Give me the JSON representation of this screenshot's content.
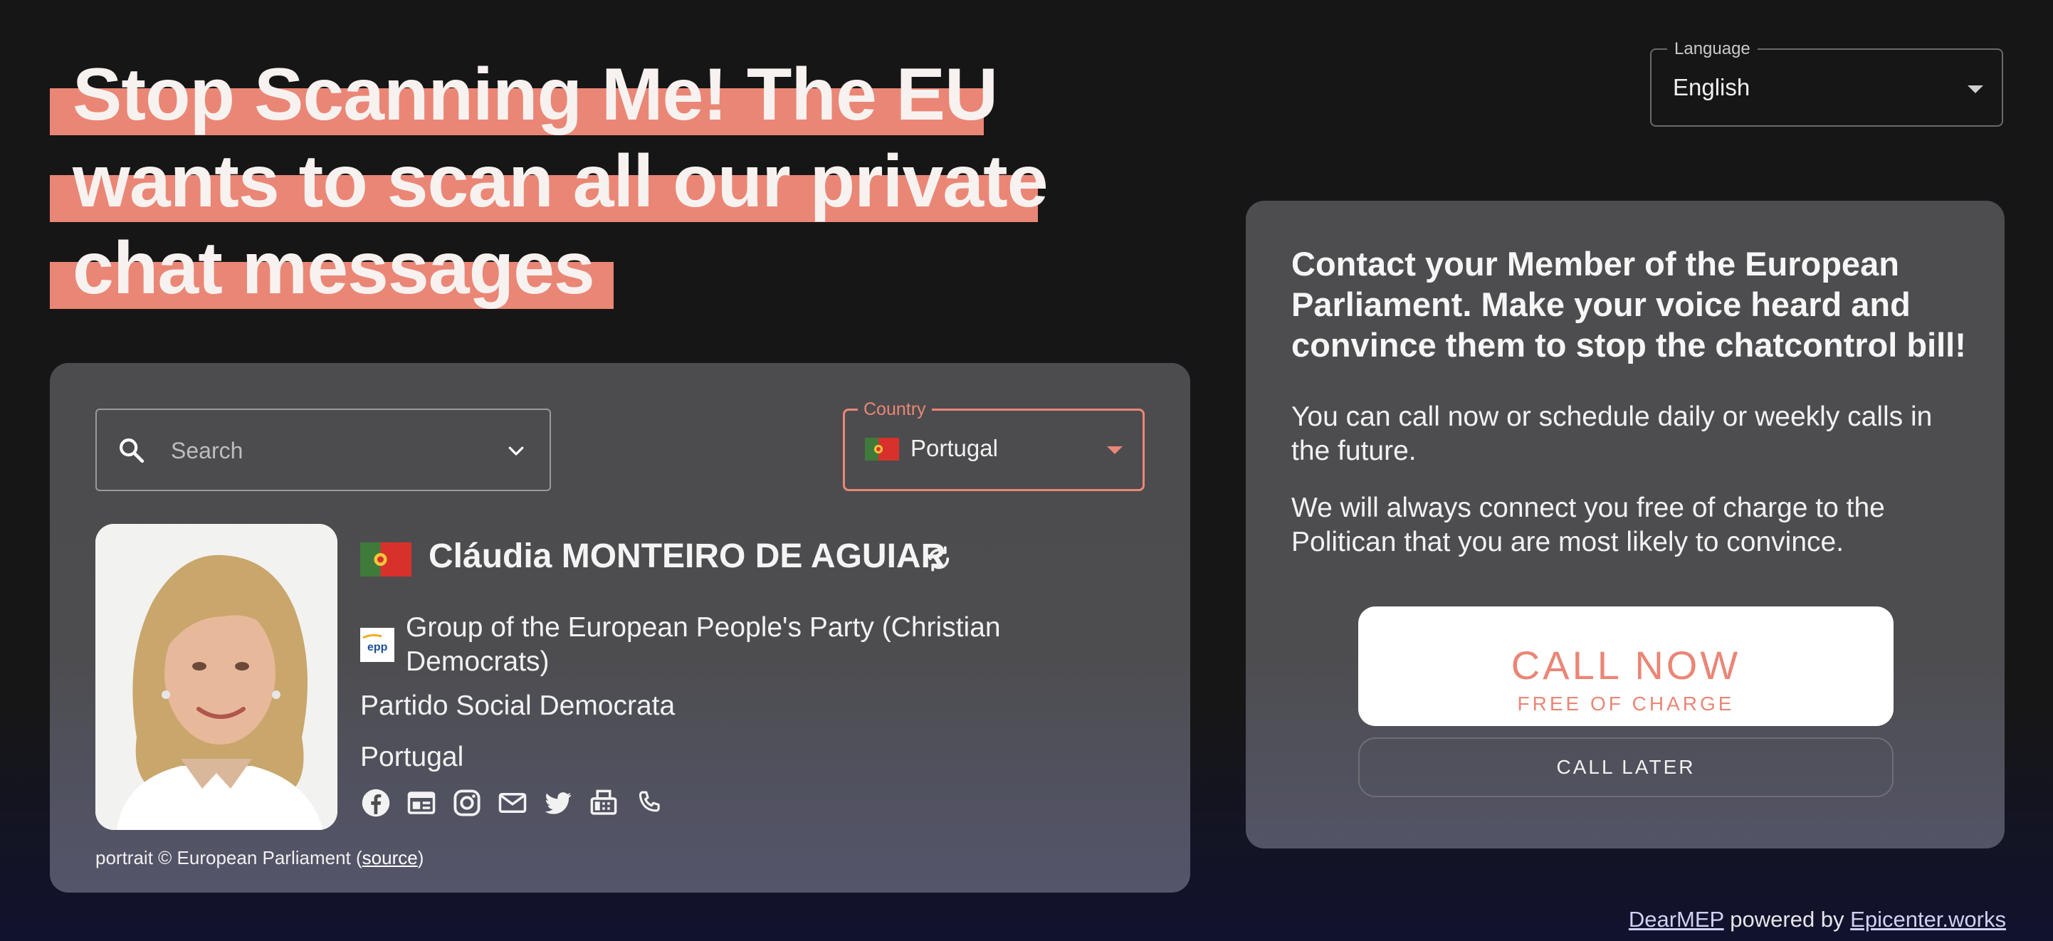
{
  "headline": {
    "lines": [
      "Stop Scanning Me! The EU",
      "wants to scan all our private",
      "chat messages"
    ]
  },
  "language_select": {
    "label": "Language",
    "value": "English"
  },
  "search": {
    "placeholder": "Search"
  },
  "country_select": {
    "label": "Country",
    "value": "Portugal"
  },
  "mep": {
    "name": "Cláudia MONTEIRO DE AGUIAR",
    "group": "Group of the European People's Party (Christian Democrats)",
    "group_logo_text": "epp",
    "party": "Partido Social Democrata",
    "country": "Portugal",
    "contact_icons": [
      "facebook-icon",
      "website-icon",
      "instagram-icon",
      "email-icon",
      "twitter-icon",
      "fax-icon",
      "phone-icon"
    ]
  },
  "credit": {
    "text": "portrait © European Parliament (",
    "link": "source",
    "close": ")"
  },
  "cta": {
    "heading": "Contact your Member of the European Parliament. Make your voice heard and convince them to stop the chatcontrol bill!",
    "p1": "You can call now or schedule daily or weekly calls in the future.",
    "p2": "We will always connect you free of charge to the Politican that you are most likely to convince.",
    "call_now": "CALL NOW",
    "call_now_sub": "FREE OF CHARGE",
    "call_later": "CALL LATER"
  },
  "footer": {
    "app": "DearMEP",
    "mid": " powered by ",
    "org": "Epicenter.works"
  },
  "colors": {
    "accent": "#ea8676",
    "background": "#161616",
    "card": "#4d4d4f"
  }
}
